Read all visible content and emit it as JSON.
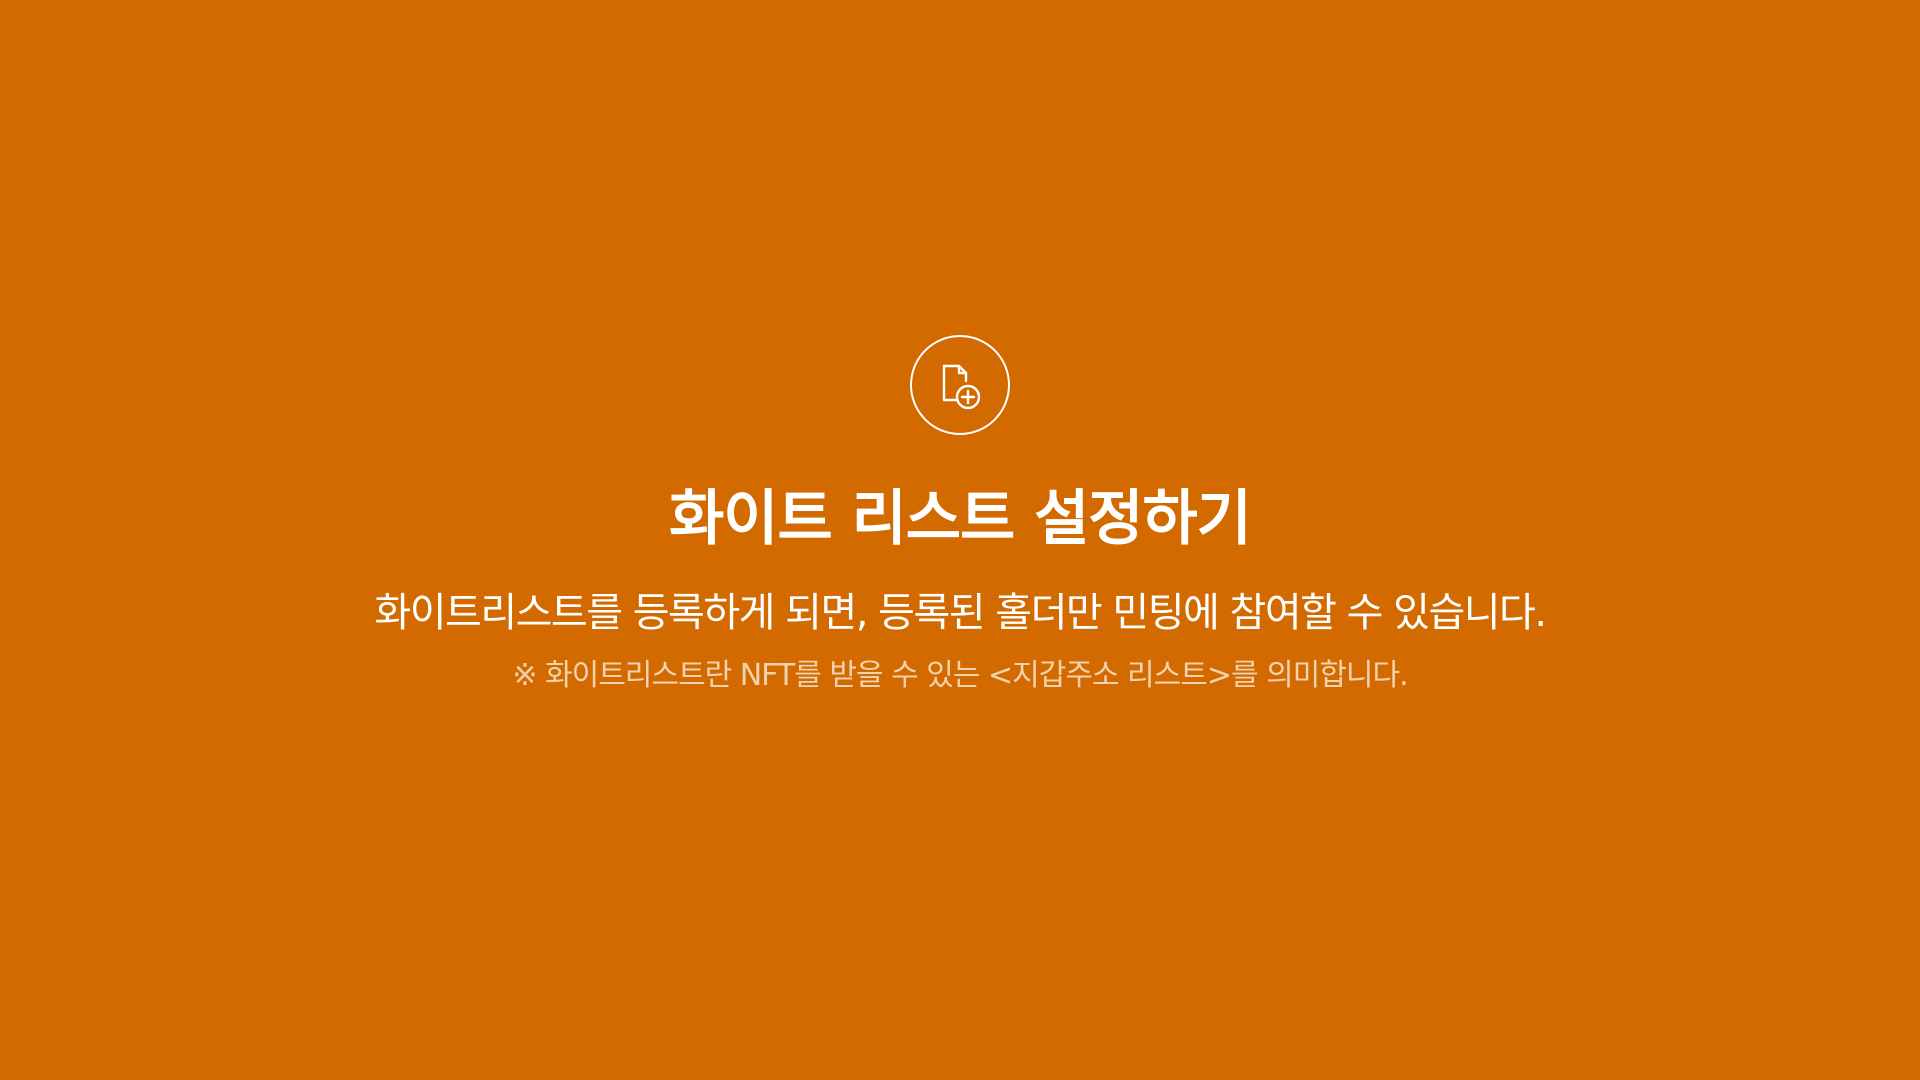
{
  "colors": {
    "background": "#D26A00",
    "text_primary": "#FFFFFF",
    "text_note": "#F3D2AE"
  },
  "icon": {
    "name": "file-add-icon"
  },
  "header": {
    "title": "화이트 리스트 설정하기"
  },
  "content": {
    "description": "화이트리스트를 등록하게 되면, 등록된 홀더만 민팅에 참여할 수 있습니다.",
    "note": "※ 화이트리스트란 NFT를 받을 수 있는 <지갑주소 리스트>를 의미합니다."
  }
}
